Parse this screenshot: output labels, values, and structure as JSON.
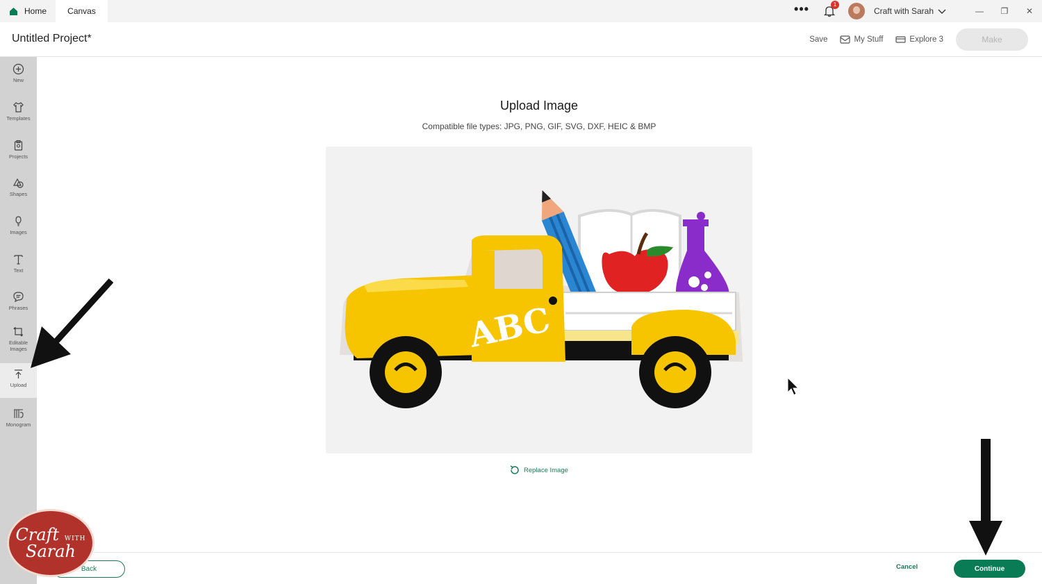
{
  "titlebar": {
    "tabs": [
      {
        "label": "Home"
      },
      {
        "label": "Canvas"
      }
    ],
    "more_label": "•••",
    "notification_count": "1",
    "user_name": "Craft with Sarah",
    "window": {
      "minimize": "—",
      "restore": "❐",
      "close": "✕"
    }
  },
  "header": {
    "project_title": "Untitled Project*",
    "save_label": "Save",
    "mystuff_label": "My Stuff",
    "machine_label": "Explore 3",
    "make_label": "Make"
  },
  "sidebar": {
    "items": [
      {
        "label": "New",
        "icon": "plus-circle-icon"
      },
      {
        "label": "Templates",
        "icon": "tshirt-icon"
      },
      {
        "label": "Projects",
        "icon": "clipboard-icon"
      },
      {
        "label": "Shapes",
        "icon": "shapes-icon"
      },
      {
        "label": "Images",
        "icon": "lightbulb-icon"
      },
      {
        "label": "Text",
        "icon": "text-icon"
      },
      {
        "label": "Phrases",
        "icon": "speech-bubble-icon"
      },
      {
        "label": "Editable Images",
        "icon": "editable-image-icon"
      },
      {
        "label": "Upload",
        "icon": "upload-icon",
        "active": true
      },
      {
        "label": "Monogram",
        "icon": "monogram-icon"
      }
    ]
  },
  "main": {
    "title": "Upload Image",
    "file_types": "Compatible file types:  JPG, PNG, GIF, SVG, DXF, HEIC & BMP",
    "preview": {
      "truck_text": "ABC"
    },
    "replace_label": "Replace Image"
  },
  "footer": {
    "back_label": "Back",
    "cancel_label": "Cancel",
    "continue_label": "Continue"
  },
  "logo": {
    "line1": "Craft",
    "with": "WITH",
    "line2": "Sarah"
  },
  "colors": {
    "accent_green": "#0a7c55",
    "sidebar_bg": "#d2d2d2",
    "notification_red": "#d9342b",
    "truck_yellow": "#f6c500",
    "logo_red": "#b0322b"
  }
}
